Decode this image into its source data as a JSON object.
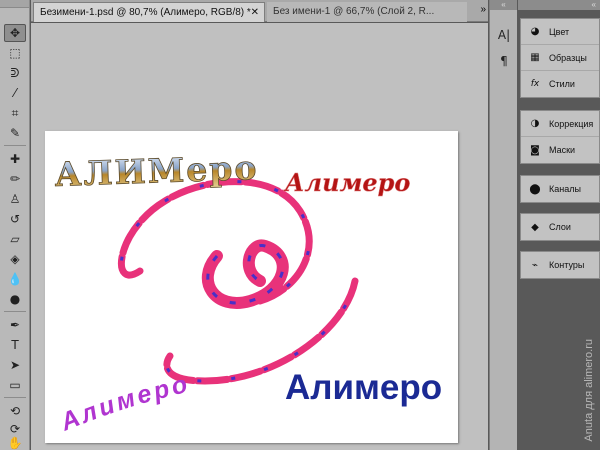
{
  "tabs": [
    {
      "label": "Безимени-1.psd @ 80,7% (Алимеро, RGB/8) *",
      "active": true
    },
    {
      "label": "Без имени-1 @ 66,7% (Слой 2, R...",
      "active": false
    }
  ],
  "tabs_more_icon": "double-chevron-right-icon",
  "toolbar": {
    "tools": [
      "move-tool-icon",
      "marquee-tool-icon",
      "lasso-tool-icon",
      "magic-wand-icon",
      "crop-tool-icon",
      "eyedropper-icon",
      "healing-brush-icon",
      "brush-tool-icon",
      "clone-stamp-icon",
      "history-brush-icon",
      "eraser-icon",
      "paint-bucket-icon",
      "blur-tool-icon",
      "dodge-tool-icon",
      "pen-tool-icon",
      "type-tool-icon",
      "path-selection-icon",
      "shape-tool-icon",
      "3d-rotate-icon",
      "3d-orbit-icon",
      "hand-tool-icon"
    ]
  },
  "canvas": {
    "texts": [
      {
        "text": "АЛИМеро",
        "style": "metallic-gradient"
      },
      {
        "text": "Алимеро",
        "style": "red-decorative"
      },
      {
        "text": "Алимеро",
        "style": "purple-arc"
      },
      {
        "text": "Алимеро",
        "style": "blue-bold"
      }
    ],
    "colors": {
      "swirl": "#e8327a",
      "swirl_accent": "#4a2fc8",
      "blue_text": "#1b2a94",
      "purple_text": "#b035d0",
      "red_text": "#b41414"
    }
  },
  "icon_strip": {
    "icons": [
      "character-panel-icon",
      "paragraph-panel-icon"
    ]
  },
  "panels": {
    "group1": [
      {
        "icon": "color-panel-icon",
        "label": "Цвет"
      },
      {
        "icon": "swatches-panel-icon",
        "label": "Образцы"
      },
      {
        "icon": "styles-panel-icon",
        "label": "Стили"
      }
    ],
    "group2": [
      {
        "icon": "adjustments-panel-icon",
        "label": "Коррекция"
      },
      {
        "icon": "masks-panel-icon",
        "label": "Маски"
      }
    ],
    "group3": [
      {
        "icon": "channels-panel-icon",
        "label": "Каналы"
      }
    ],
    "group4": [
      {
        "icon": "layers-panel-icon",
        "label": "Слои"
      }
    ],
    "group5": [
      {
        "icon": "paths-panel-icon",
        "label": "Контуры"
      }
    ]
  },
  "watermark": "Anuta для alimero.ru"
}
